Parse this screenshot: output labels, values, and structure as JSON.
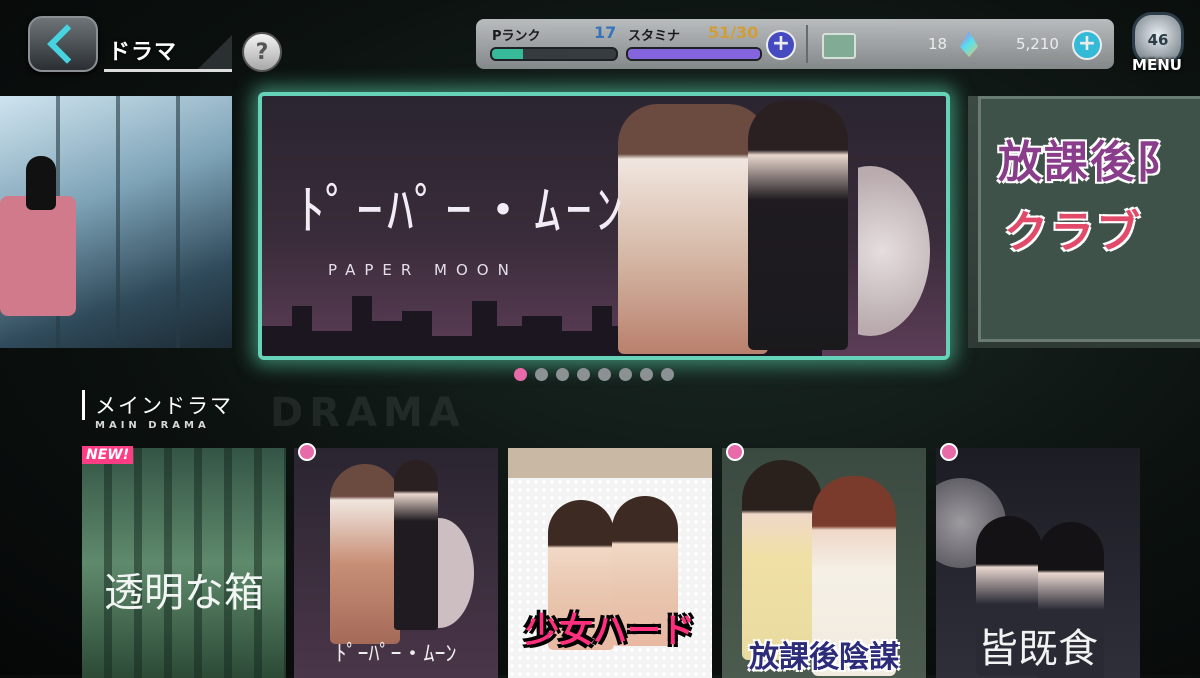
{
  "header": {
    "title": "ドラマ",
    "help_label": "?",
    "p_rank_label": "Pランク",
    "p_rank_value": "17",
    "p_rank_progress": 0.25,
    "stamina_label": "スタミナ",
    "stamina_value": "51/30",
    "stamina_progress": 1.0,
    "gems": "18",
    "coins": "5,210",
    "plus": "+",
    "menu_level": "46",
    "menu_label": "MENU"
  },
  "carousel": {
    "main_title": "ﾄﾟｰﾊﾟｰ・ﾑｰﾝ",
    "main_subtitle": "PAPER MOON",
    "right_title_line1": "放課後阝",
    "right_title_line2": "クラブ",
    "dot_count": 8,
    "active_dot": 0
  },
  "section": {
    "title_jp": "メインドラマ",
    "title_en": "MAIN DRAMA",
    "bg_word": "DRAMA"
  },
  "cards": [
    {
      "title": "透明な箱",
      "badge": "NEW!"
    },
    {
      "title": "ﾄﾟｰﾊﾟｰ・ﾑｰﾝ"
    },
    {
      "title": "少女ハード"
    },
    {
      "title": "放課後陰謀"
    },
    {
      "title": "皆既食"
    }
  ],
  "colors": {
    "accent_cyan": "#46d4e0",
    "banner_glow": "#66d3b8",
    "pink": "#e96aa9",
    "stamina_purple": "#8f6cf0"
  }
}
